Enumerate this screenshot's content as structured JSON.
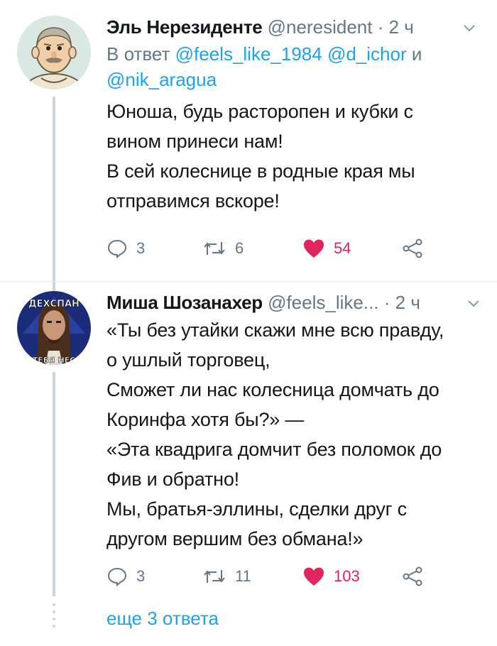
{
  "tweets": [
    {
      "author": "Эль Нерезиденте",
      "handle": "@neresident",
      "separator": "·",
      "time": "2 ч",
      "reply_prefix": "В ответ",
      "reply_mention_1": "@feels_like_1984",
      "reply_mention_2": "@d_ichor",
      "reply_and": "и",
      "reply_mention_3": "@nik_aragua",
      "lines": [
        "Юноша, будь расторопен и кубки с",
        "вином принеси нам!",
        "В сей колеснице в родные края мы",
        "отправимся вскоре!"
      ],
      "reply_count": "3",
      "retweet_count": "6",
      "like_count": "54"
    },
    {
      "author": "Миша Шозанахер",
      "handle": "@feels_like...",
      "separator": "·",
      "time": "2 ч",
      "lines": [
        "«Ты без утайки скажи мне всю правду,",
        "о ушлый торговец,",
        "Сможет ли нас колесница домчать до",
        "Коринфа хотя бы?» —",
        "«Эта квадрига домчит без поломок до",
        "Фив и обратно!",
        "Мы, братья-эллины, сделки друг с",
        "другом вершим без обмана!»"
      ],
      "reply_count": "3",
      "retweet_count": "11",
      "like_count": "103",
      "avatar_caption_top": "ДЕХСПАН",
      "avatar_caption_bottom": "ТЕБЯ НЕС"
    }
  ],
  "more_replies": "еще 3 ответа",
  "colors": {
    "link": "#1da1f2",
    "muted": "#657786",
    "like": "#e0245e",
    "line": "#ccd6dd"
  },
  "icons": [
    "reply-icon",
    "retweet-icon",
    "like-icon",
    "share-icon",
    "chevron-down-icon"
  ]
}
